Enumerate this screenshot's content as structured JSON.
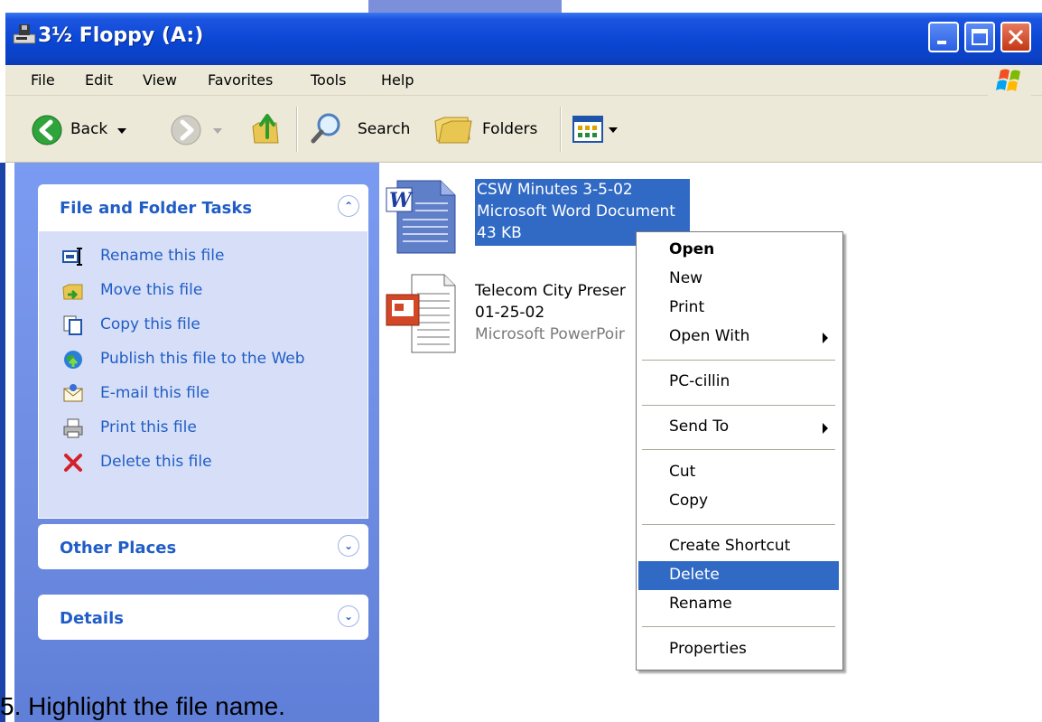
{
  "window": {
    "title": "3½ Floppy (A:)"
  },
  "menubar": {
    "items": [
      "File",
      "Edit",
      "View",
      "Favorites",
      "Tools",
      "Help"
    ]
  },
  "toolbar": {
    "back_label": "Back",
    "search_label": "Search",
    "folders_label": "Folders"
  },
  "taskpane": {
    "file_tasks": {
      "title": "File and Folder Tasks",
      "items": [
        {
          "label": "Rename this file",
          "icon": "rename-icon"
        },
        {
          "label": "Move this file",
          "icon": "move-icon"
        },
        {
          "label": "Copy this file",
          "icon": "copy-icon"
        },
        {
          "label": "Publish this file to the Web",
          "icon": "publish-web-icon"
        },
        {
          "label": "E-mail this file",
          "icon": "email-icon"
        },
        {
          "label": "Print this file",
          "icon": "printer-icon"
        },
        {
          "label": "Delete this file",
          "icon": "delete-x-icon"
        }
      ]
    },
    "other_places": {
      "title": "Other Places"
    },
    "details": {
      "title": "Details"
    }
  },
  "files": [
    {
      "name": "CSW Minutes 3-5-02",
      "type": "Microsoft Word Document",
      "size": "43 KB",
      "selected": true,
      "icon": "word-document-icon"
    },
    {
      "name": "Telecom City Preser",
      "date": "01-25-02",
      "type": "Microsoft PowerPoir",
      "selected": false,
      "icon": "powerpoint-document-icon"
    }
  ],
  "context_menu": {
    "items": [
      "Open",
      "New",
      "Print",
      "Open With",
      "PC-cillin",
      "Send To",
      "Cut",
      "Copy",
      "Create Shortcut",
      "Delete",
      "Rename",
      "Properties"
    ],
    "default_item": "Open",
    "highlighted_item": "Delete",
    "highlight_color": "#316ac5"
  },
  "caption": {
    "text": "5.  Highlight the file name."
  }
}
